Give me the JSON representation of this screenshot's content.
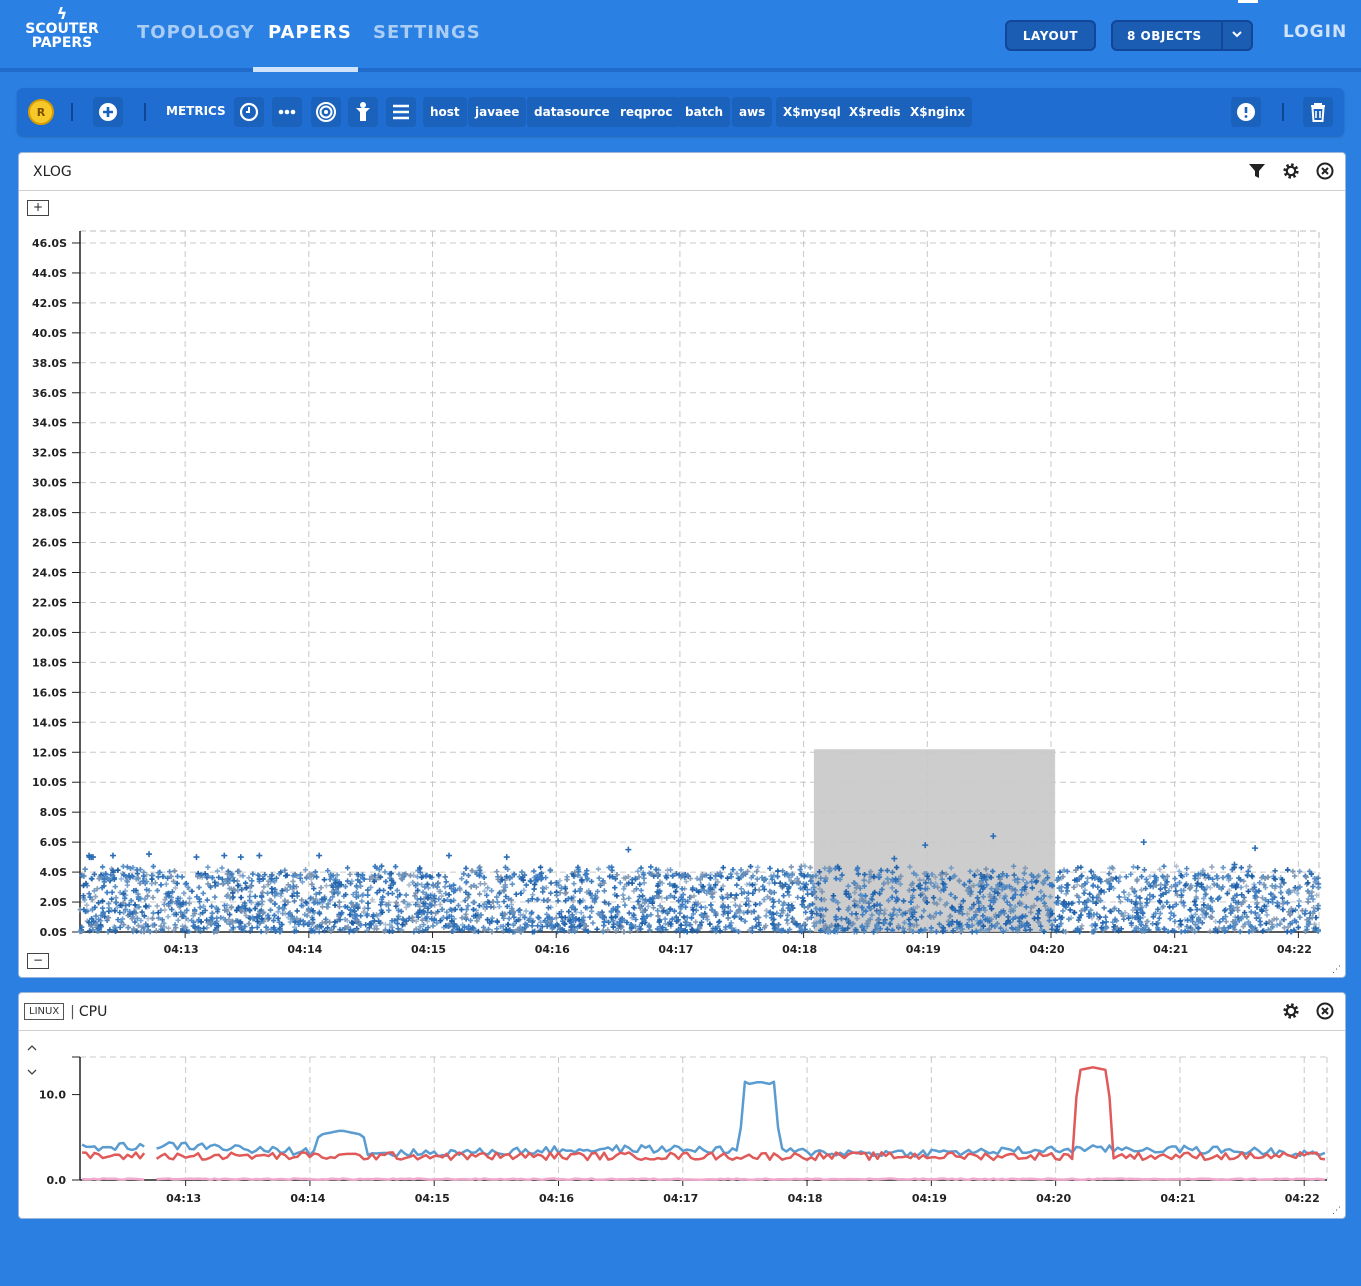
{
  "app": {
    "logo_top": "SCOUTER",
    "logo_bottom": "PAPERS"
  },
  "nav": {
    "topology": "TOPOLOGY",
    "papers": "PAPERS",
    "settings": "SETTINGS"
  },
  "header": {
    "layout_button": "LAYOUT",
    "objects_button": "8 OBJECTS",
    "login": "LOGIN"
  },
  "toolbar": {
    "realtime_badge": "R",
    "metrics_label": "METRICS",
    "tags": [
      "host",
      "javaee",
      "datasource",
      "reqproc",
      "batch",
      "aws",
      "X$mysql",
      "X$redis",
      "X$nginx"
    ]
  },
  "xlog_panel": {
    "title": "XLOG",
    "zoom_in": "+",
    "zoom_out": "−"
  },
  "cpu_panel": {
    "tag": "LINUX",
    "separator": "|",
    "title": "CPU"
  },
  "colors": {
    "background": "#2b7fe0",
    "toolbar": "#1f6dd0",
    "scatter": "#2a6db4",
    "series_blue": "#5a9bd0",
    "series_red": "#e05a5a",
    "series_pink": "#f0a8cc",
    "highlight": "#c8c8c8"
  },
  "chart_data": [
    {
      "type": "scatter",
      "y_ticks": [
        "0.0S",
        "2.0S",
        "4.0S",
        "6.0S",
        "8.0S",
        "10.0S",
        "12.0S",
        "14.0S",
        "16.0S",
        "18.0S",
        "20.0S",
        "22.0S",
        "24.0S",
        "26.0S",
        "28.0S",
        "30.0S",
        "32.0S",
        "34.0S",
        "36.0S",
        "38.0S",
        "40.0S",
        "42.0S",
        "44.0S",
        "46.0S"
      ],
      "x_ticks": [
        "04:13",
        "04:14",
        "04:15",
        "04:16",
        "04:17",
        "04:18",
        "04:19",
        "04:20",
        "04:21",
        "04:22"
      ],
      "ylim": [
        0,
        46.8
      ],
      "xlim": [
        "04:12:09",
        "04:22:10"
      ],
      "grid": true,
      "selection": {
        "x_start": "04:18:05",
        "x_end": "04:20:02",
        "y_start": 0,
        "y_end": 12.2
      },
      "note_points": "dense response-time points mostly 0–4s with sparse outliers up to ~6.5s",
      "outliers": [
        [
          4.4,
          5.1
        ],
        [
          4.6,
          5.0
        ],
        [
          5.5,
          5.0
        ],
        [
          6.3,
          5.0
        ],
        [
          16.0,
          5.1
        ],
        [
          33.5,
          5.2
        ],
        [
          56.5,
          5.0
        ],
        [
          70.0,
          5.1
        ],
        [
          78.0,
          5.0
        ],
        [
          87.0,
          5.1
        ],
        [
          116.0,
          5.1
        ],
        [
          179.0,
          5.1
        ],
        [
          207.0,
          5.0
        ],
        [
          266.0,
          5.5
        ],
        [
          395.0,
          4.9
        ],
        [
          410.0,
          5.8
        ],
        [
          443.0,
          6.4
        ],
        [
          516.0,
          6.0
        ],
        [
          560.0,
          4.5
        ],
        [
          570.0,
          5.6
        ]
      ]
    },
    {
      "type": "line",
      "y_ticks": [
        "0.0",
        "10.0"
      ],
      "x_ticks": [
        "04:13",
        "04:14",
        "04:15",
        "04:16",
        "04:17",
        "04:18",
        "04:19",
        "04:20",
        "04:21",
        "04:22"
      ],
      "ylim": [
        0,
        14.4
      ],
      "xlim": [
        "04:12:09",
        "04:22:11"
      ],
      "grid": true,
      "series": [
        {
          "color": "#5a9bd0",
          "baseline": 3.4,
          "spikes": [
            {
              "at": "04:14:15",
              "peak": 5.8
            },
            {
              "at": "04:17:37",
              "peak": 11.5
            }
          ]
        },
        {
          "color": "#e05a5a",
          "baseline": 2.8,
          "spikes": [
            {
              "at": "04:20:18",
              "peak": 13.2
            }
          ]
        },
        {
          "color": "#f0a8cc",
          "baseline": 0.1,
          "spikes": []
        }
      ]
    }
  ]
}
